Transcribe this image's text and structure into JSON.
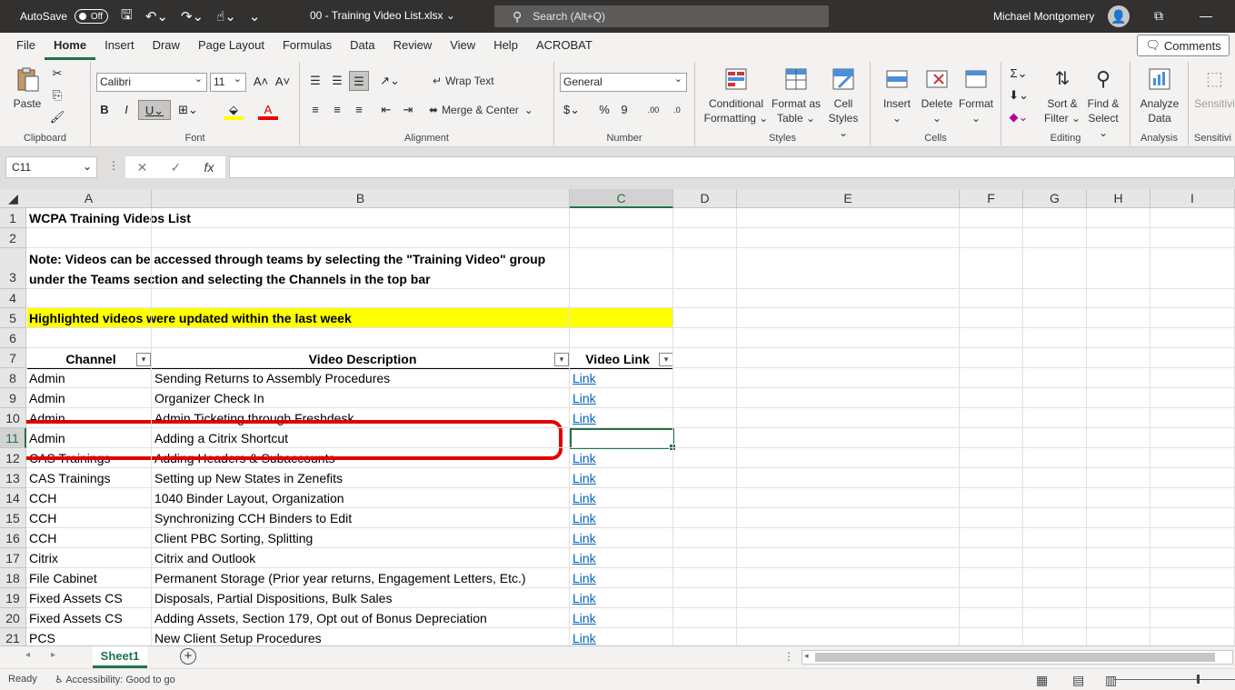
{
  "titlebar": {
    "autosave_label": "AutoSave",
    "autosave_state": "Off",
    "filename": "00 - Training Video List.xlsx ⌄",
    "search_placeholder": "Search (Alt+Q)",
    "user_name": "Michael Montgomery"
  },
  "menu": {
    "tabs": [
      "File",
      "Home",
      "Insert",
      "Draw",
      "Page Layout",
      "Formulas",
      "Data",
      "Review",
      "View",
      "Help",
      "ACROBAT"
    ],
    "active": "Home",
    "comments_label": "Comments"
  },
  "ribbon": {
    "clipboard": {
      "paste": "Paste",
      "label": "Clipboard"
    },
    "font": {
      "name": "Calibri",
      "size": "11",
      "label": "Font"
    },
    "alignment": {
      "wrap_text": "Wrap Text",
      "merge_center": "Merge & Center",
      "label": "Alignment"
    },
    "number": {
      "format": "General",
      "label": "Number"
    },
    "styles": {
      "conditional": "Conditional",
      "conditional2": "Formatting ⌄",
      "format_as": "Format as",
      "format_as2": "Table ⌄",
      "cell": "Cell",
      "cell2": "Styles ⌄",
      "label": "Styles"
    },
    "cells": {
      "insert": "Insert",
      "delete": "Delete",
      "format": "Format",
      "label": "Cells"
    },
    "editing": {
      "sort": "Sort &",
      "sort2": "Filter ⌄",
      "find": "Find &",
      "find2": "Select ⌄",
      "label": "Editing"
    },
    "analysis": {
      "analyze": "Analyze",
      "analyze2": "Data",
      "label": "Analysis"
    },
    "sensitivity": {
      "label1": "Sensitivi",
      "label2": "Sensitivi"
    }
  },
  "formula_bar": {
    "name_box": "C11",
    "formula": ""
  },
  "sheet": {
    "columns": [
      "A",
      "B",
      "C",
      "D",
      "E",
      "F",
      "G",
      "H",
      "I"
    ],
    "selected_column": "C",
    "selected_row": "11",
    "rows": [
      "1",
      "2",
      "3",
      "4",
      "5",
      "6",
      "7",
      "8",
      "9",
      "10",
      "11",
      "12",
      "13",
      "14",
      "15",
      "16",
      "17",
      "18",
      "19",
      "20",
      "21"
    ],
    "title": "WCPA Training Videos List",
    "note_line1": "Note: Videos can be accessed through teams by selecting the \"Training Video\" group",
    "note_line2": "under the Teams section and selecting the Channels in the top bar",
    "highlight_note": "Highlighted videos were updated within the last week",
    "headers": {
      "channel": "Channel",
      "description": "Video Description",
      "link": "Video Link"
    },
    "data": [
      {
        "channel": "Admin",
        "description": "Sending Returns to Assembly Procedures",
        "link": "Link"
      },
      {
        "channel": "Admin",
        "description": "Organizer Check In",
        "link": "Link"
      },
      {
        "channel": "Admin",
        "description": "Admin Ticketing through Freshdesk",
        "link": "Link"
      },
      {
        "channel": "Admin",
        "description": "Adding a Citrix Shortcut",
        "link": ""
      },
      {
        "channel": "CAS Trainings",
        "description": "Adding Headers & Subaccounts",
        "link": "Link"
      },
      {
        "channel": "CAS Trainings",
        "description": "Setting up New States in Zenefits",
        "link": "Link"
      },
      {
        "channel": "CCH",
        "description": "1040 Binder Layout, Organization",
        "link": "Link"
      },
      {
        "channel": "CCH",
        "description": "Synchronizing CCH Binders to Edit",
        "link": "Link"
      },
      {
        "channel": "CCH",
        "description": "Client PBC Sorting, Splitting",
        "link": "Link"
      },
      {
        "channel": "Citrix",
        "description": "Citrix and Outlook",
        "link": "Link"
      },
      {
        "channel": "File Cabinet",
        "description": "Permanent Storage (Prior year returns, Engagement Letters, Etc.)",
        "link": "Link"
      },
      {
        "channel": "Fixed Assets CS",
        "description": "Disposals, Partial Dispositions, Bulk Sales",
        "link": "Link"
      },
      {
        "channel": "Fixed Assets CS",
        "description": "Adding Assets, Section 179, Opt out of Bonus Depreciation",
        "link": "Link"
      },
      {
        "channel": "PCS",
        "description": "New Client Setup Procedures",
        "link": "Link"
      }
    ]
  },
  "sheet_tabs": {
    "active": "Sheet1"
  },
  "status": {
    "ready": "Ready",
    "accessibility": "Accessibility: Good to go"
  },
  "colors": {
    "excel_green": "#217346",
    "highlight": "#ffff00",
    "annotation": "#e00000",
    "link": "#0563c1"
  }
}
